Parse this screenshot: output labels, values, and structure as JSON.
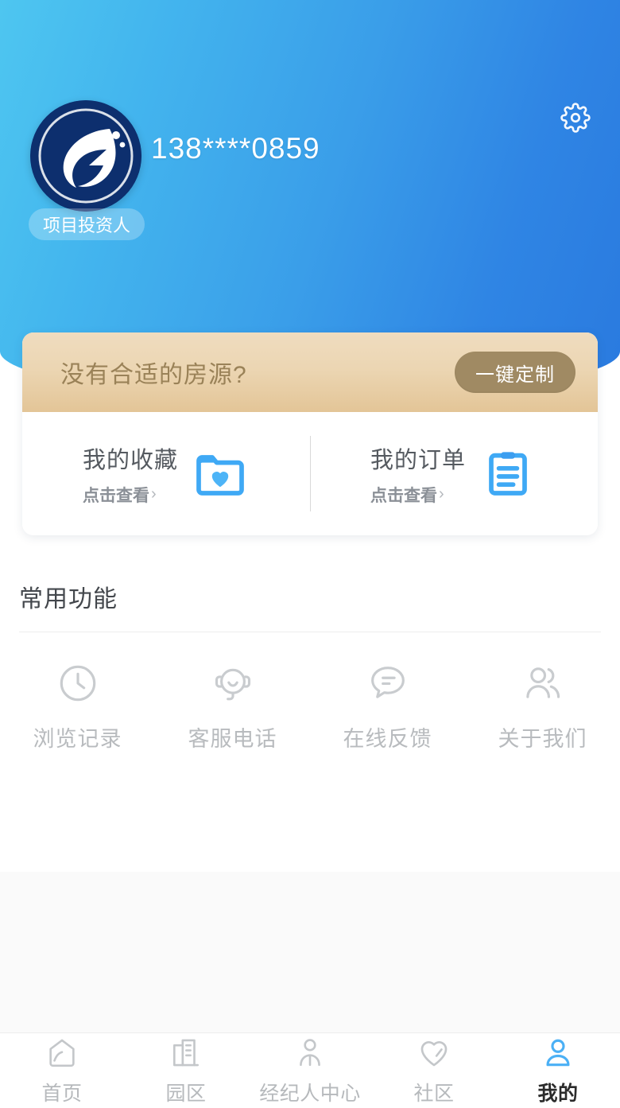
{
  "header": {
    "phone": "138****0859",
    "role_badge": "项目投资人",
    "settings_icon": "gear-icon",
    "avatar_icon": "company-logo-avatar",
    "gradient_from": "#4ec6f0",
    "gradient_to": "#2a7adf"
  },
  "custom_card": {
    "banner_text": "没有合适的房源?",
    "banner_button": "一键定制",
    "banner_bg": "#ecd6b3",
    "banner_button_bg": "#a08a63",
    "columns": [
      {
        "title": "我的收藏",
        "sub": "点击查看",
        "chevron": "›",
        "icon": "folder-heart-icon",
        "icon_color": "#3fa9f5"
      },
      {
        "title": "我的订单",
        "sub": "点击查看",
        "chevron": "›",
        "icon": "clipboard-icon",
        "icon_color": "#3fa9f5"
      }
    ]
  },
  "common_functions": {
    "title": "常用功能",
    "items": [
      {
        "label": "浏览记录",
        "icon": "clock-icon"
      },
      {
        "label": "客服电话",
        "icon": "headset-icon"
      },
      {
        "label": "在线反馈",
        "icon": "speech-bubble-icon"
      },
      {
        "label": "关于我们",
        "icon": "people-icon"
      }
    ],
    "icon_color": "#c9cccf",
    "label_color": "#b8bbbe"
  },
  "tabbar": {
    "active_color": "#4bb0f5",
    "inactive_color": "#b6b9bc",
    "items": [
      {
        "label": "首页",
        "icon": "home-icon",
        "active": false
      },
      {
        "label": "园区",
        "icon": "building-icon",
        "active": false
      },
      {
        "label": "经纪人中心",
        "icon": "agent-icon",
        "active": false
      },
      {
        "label": "社区",
        "icon": "heart-icon",
        "active": false
      },
      {
        "label": "我的",
        "icon": "person-icon",
        "active": true
      }
    ]
  }
}
